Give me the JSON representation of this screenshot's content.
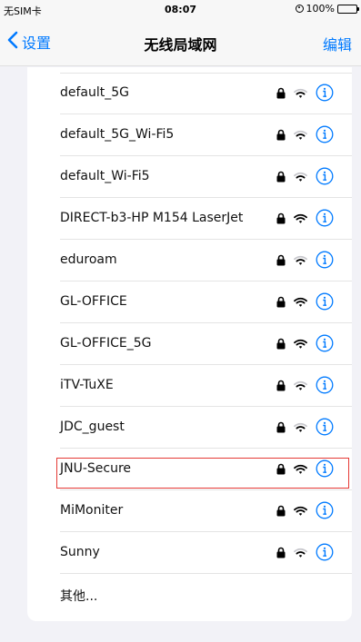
{
  "status_bar": {
    "carrier": "无SIM卡",
    "time": "08:07",
    "battery": "100%"
  },
  "nav": {
    "back_label": "设置",
    "title": "无线局域网",
    "edit_label": "编辑"
  },
  "networks": [
    {
      "name": "default_5G",
      "secured": true
    },
    {
      "name": "default_5G_Wi-Fi5",
      "secured": true
    },
    {
      "name": "default_Wi-Fi5",
      "secured": true
    },
    {
      "name": "DIRECT-b3-HP M154 LaserJet",
      "secured": true
    },
    {
      "name": "eduroam",
      "secured": true
    },
    {
      "name": "GL-OFFICE",
      "secured": true
    },
    {
      "name": "GL-OFFICE_5G",
      "secured": true
    },
    {
      "name": "iTV-TuXE",
      "secured": true
    },
    {
      "name": "JDC_guest",
      "secured": true
    },
    {
      "name": "JNU-Secure",
      "secured": true,
      "highlighted": true
    },
    {
      "name": "MiMoniter",
      "secured": true
    },
    {
      "name": "Sunny",
      "secured": true
    }
  ],
  "other_label": "其他...",
  "colors": {
    "accent": "#007aff",
    "highlight": "#e53935"
  }
}
